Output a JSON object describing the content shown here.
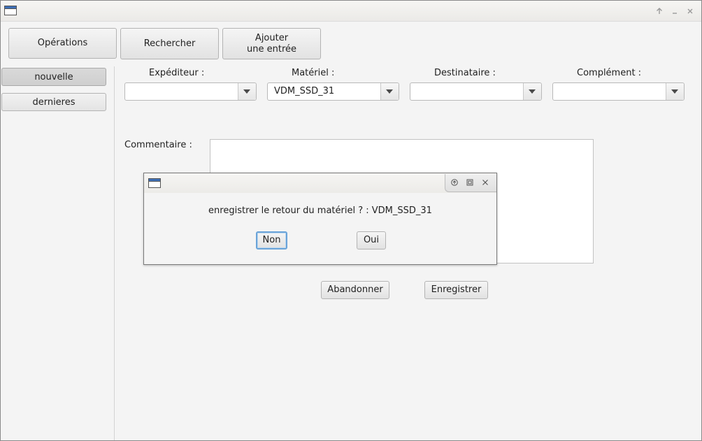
{
  "window": {
    "controls": {
      "up_icon": "arrow-up-icon",
      "minimize_icon": "minimize-icon",
      "close_icon": "close-icon"
    }
  },
  "toolbar": {
    "operations": "Opérations",
    "search": "Rechercher",
    "add_line1": "Ajouter",
    "add_line2": "une entrée"
  },
  "sidebar": {
    "items": [
      {
        "label": "nouvelle",
        "active": true
      },
      {
        "label": "dernieres",
        "active": false
      }
    ]
  },
  "form": {
    "sender_label": "Expéditeur :",
    "sender_value": "",
    "material_label": "Matériel :",
    "material_value": "VDM_SSD_31",
    "recipient_label": "Destinataire :",
    "recipient_value": "",
    "complement_label": "Complément :",
    "complement_value": "",
    "comment_label": "Commentaire :",
    "comment_value": "",
    "cancel_label": "Abandonner",
    "save_label": "Enregistrer"
  },
  "dialog": {
    "message": "enregistrer le retour du matériel ? : VDM_SSD_31",
    "no_label": "Non",
    "yes_label": "Oui",
    "focus_color": "#6aa3d8"
  }
}
